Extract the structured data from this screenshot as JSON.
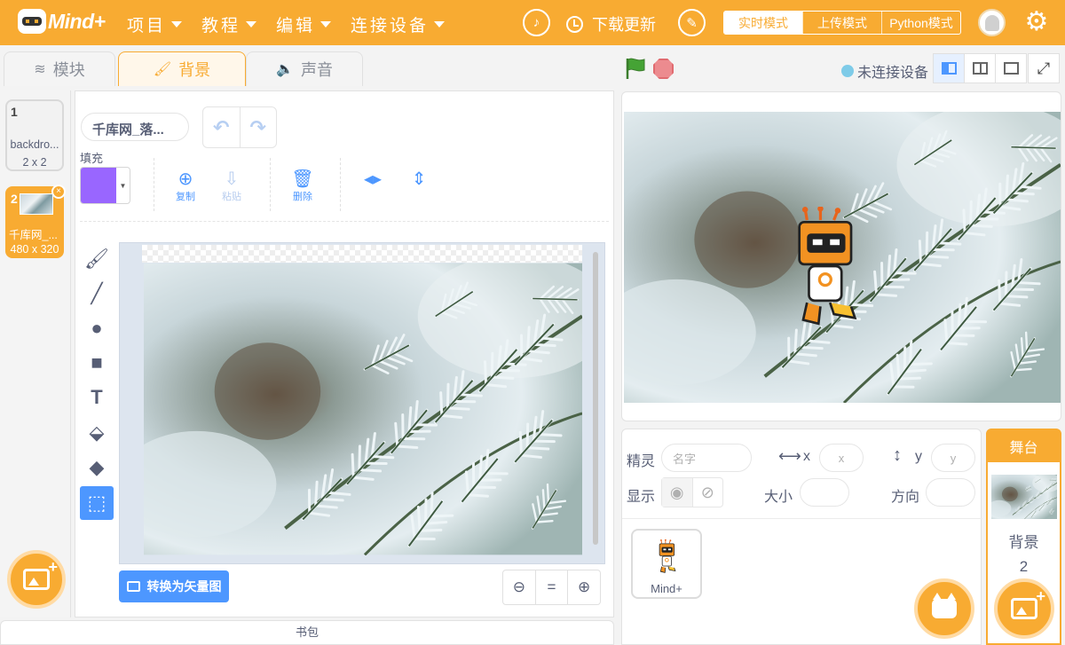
{
  "app": {
    "logo_text": "Mind+"
  },
  "menu": {
    "items": [
      {
        "label": "项目"
      },
      {
        "label": "教程"
      },
      {
        "label": "编辑"
      },
      {
        "label": "连接设备"
      }
    ],
    "download_label": "下载更新",
    "modes": [
      {
        "label": "实时模式",
        "active": true
      },
      {
        "label": "上传模式",
        "active": false
      },
      {
        "label": "Python模式",
        "active": false
      }
    ]
  },
  "editor_tabs": [
    {
      "label": "模块",
      "active": false
    },
    {
      "label": "背景",
      "active": true
    },
    {
      "label": "声音",
      "active": false
    }
  ],
  "backdrops": [
    {
      "number": "1",
      "name": "backdro...",
      "size": "2 x 2",
      "selected": false
    },
    {
      "number": "2",
      "name": "千库网_...",
      "size": "480 x 320",
      "selected": true
    }
  ],
  "paint": {
    "name_value": "千库网_落...",
    "fill_label": "填充",
    "fill_color": "#9966ff",
    "actions": [
      {
        "label": "复制",
        "icon": "copy-icon",
        "enabled": true
      },
      {
        "label": "粘贴",
        "icon": "paste-icon",
        "enabled": false
      },
      {
        "label": "删除",
        "icon": "trash-icon",
        "enabled": true
      }
    ],
    "tools": [
      "brush-icon",
      "line-icon",
      "circle-icon",
      "rectangle-icon",
      "text-icon",
      "fill-icon",
      "eraser-icon",
      "select-icon"
    ],
    "active_tool": "select-icon",
    "convert_label": "转换为矢量图",
    "zoom_reset": "="
  },
  "backpack_label": "书包",
  "stage_header": {
    "connection_label": "未连接设备"
  },
  "sprite_info": {
    "sprite_label": "精灵",
    "name_placeholder": "名字",
    "x_label": "x",
    "x_placeholder": "x",
    "y_label": "y",
    "y_placeholder": "y",
    "show_label": "显示",
    "size_label": "大小",
    "direction_label": "方向"
  },
  "sprites": [
    {
      "name": "Mind+"
    }
  ],
  "stage_panel": {
    "header": "舞台",
    "backdrop_label": "背景",
    "backdrop_count": "2"
  },
  "colors": {
    "accent": "#f8ab32",
    "blue": "#4d97ff",
    "text": "#575e75"
  }
}
